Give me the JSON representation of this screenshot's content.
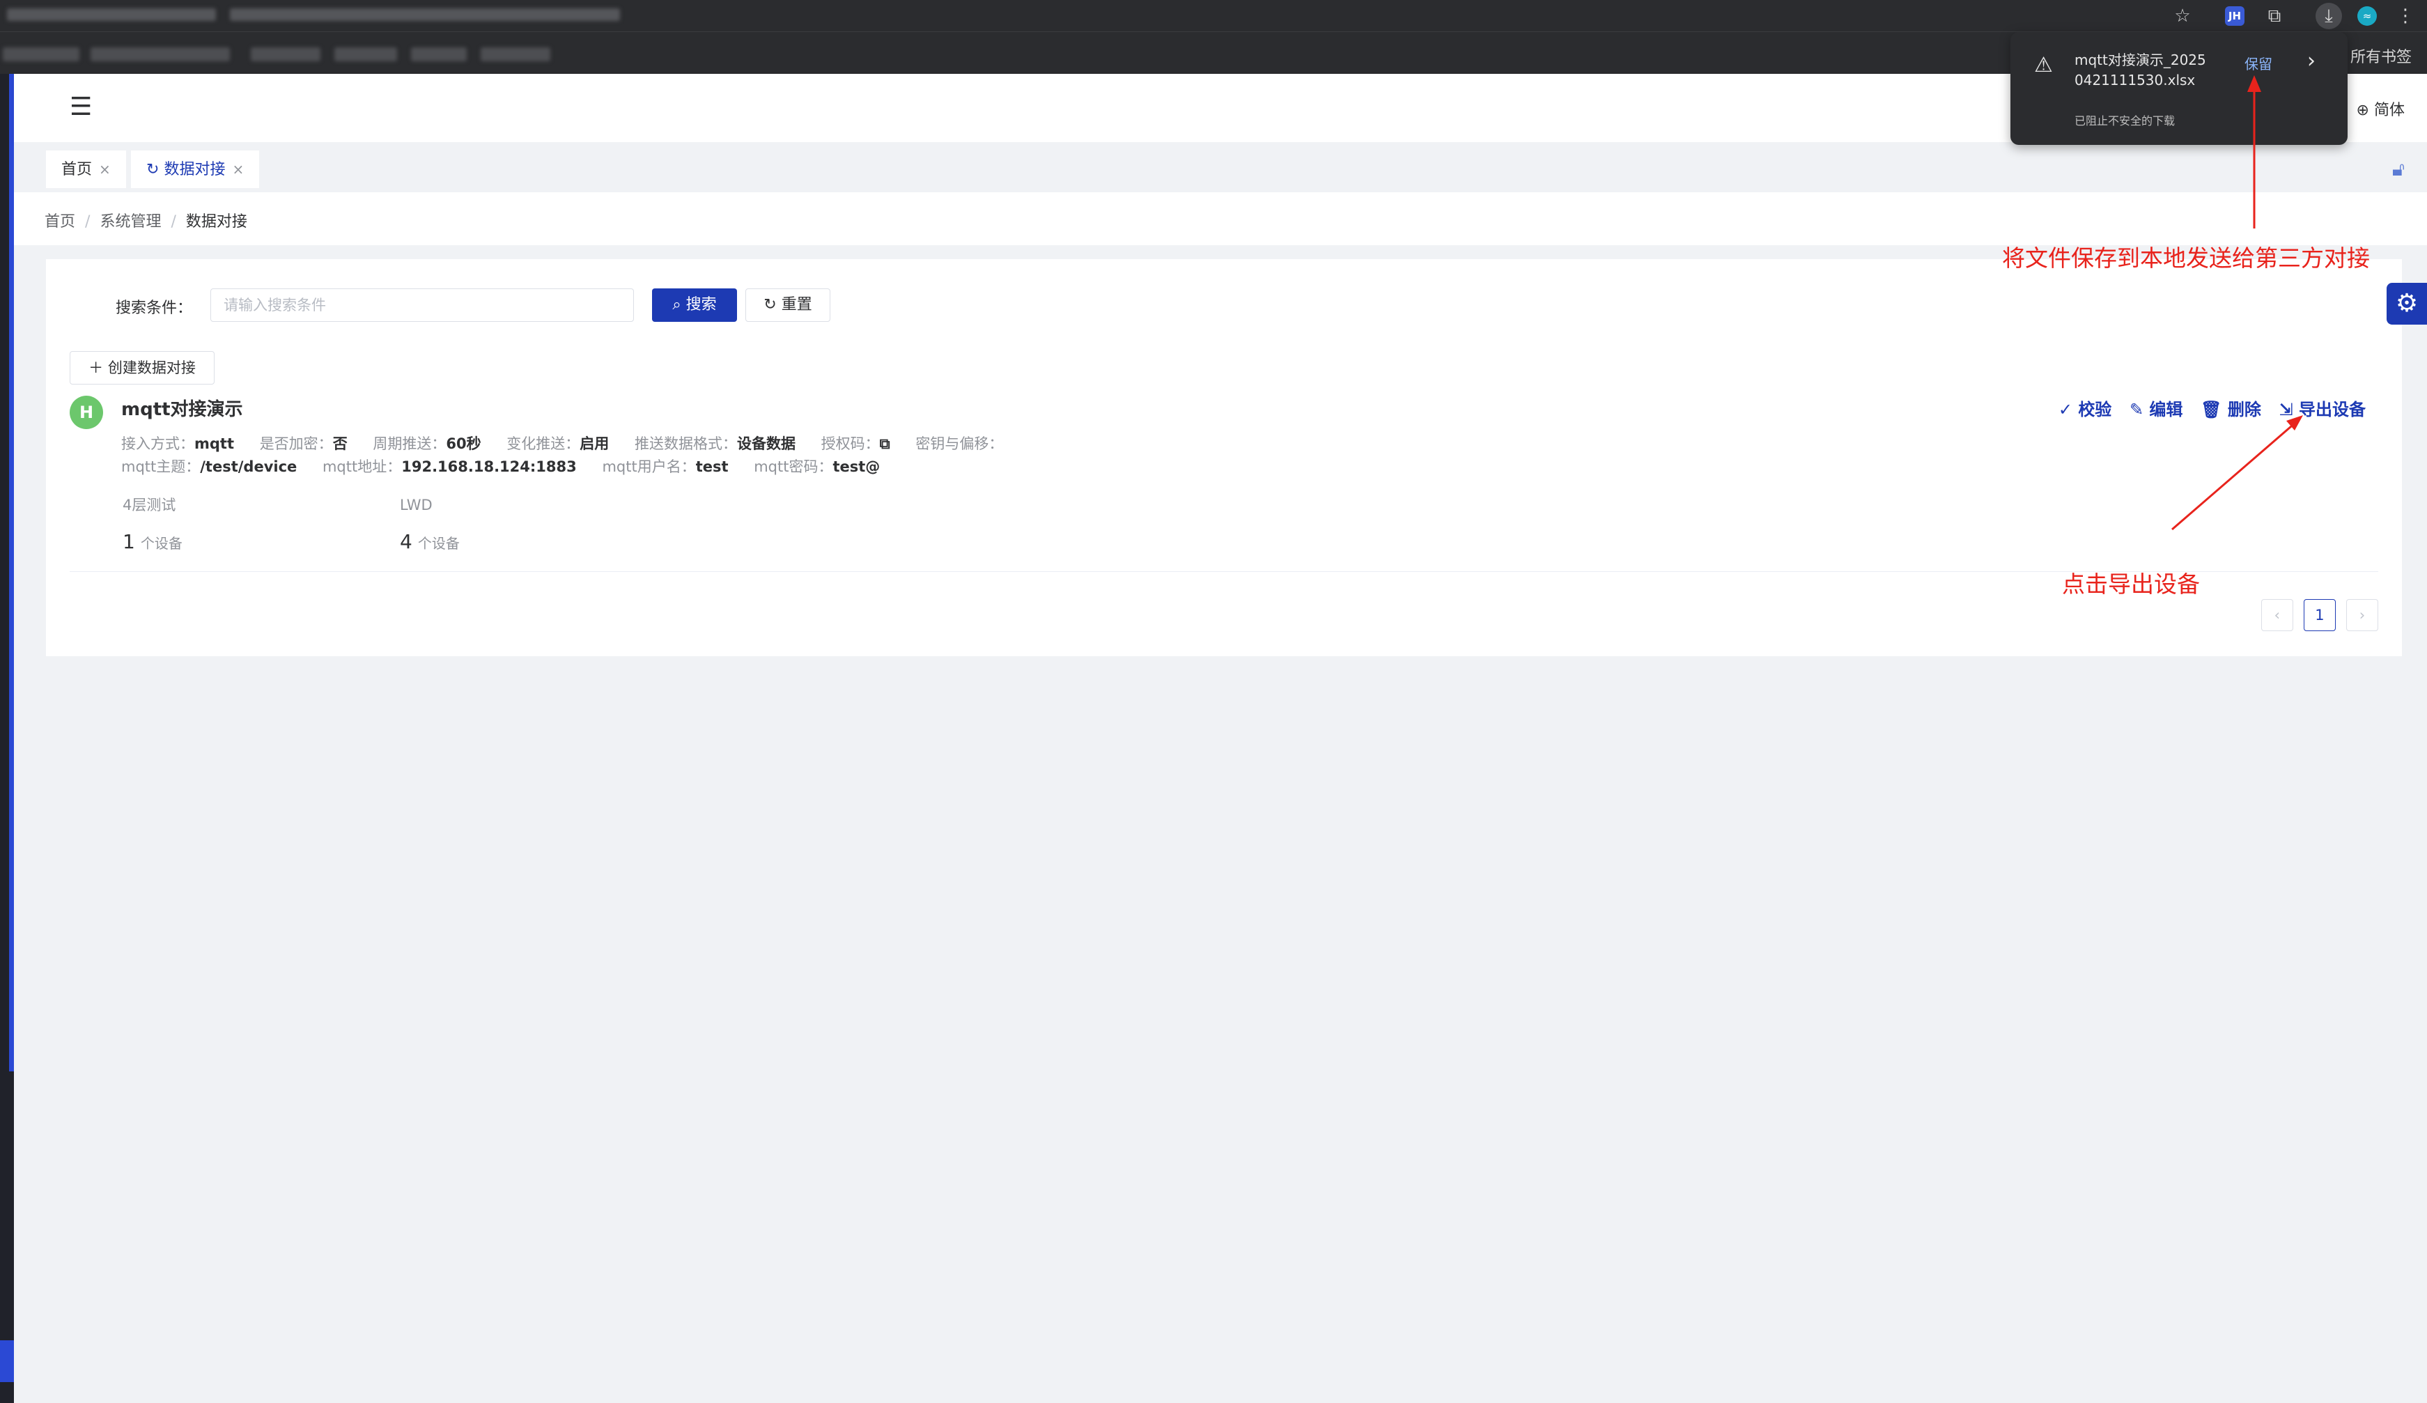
{
  "browser": {
    "all_bookmarks": "所有书签",
    "profile_jh": "JH",
    "avatar_initial": "≈"
  },
  "download_popup": {
    "filename": "mqtt对接演示_20250421111530.xlsx",
    "status": "已阻止不安全的下载",
    "keep_label": "保留"
  },
  "header": {
    "language": "简体"
  },
  "tabs": [
    {
      "label": "首页"
    },
    {
      "label": "数据对接"
    }
  ],
  "breadcrumb": [
    "首页",
    "系统管理",
    "数据对接"
  ],
  "search": {
    "label": "搜索条件：",
    "placeholder": "请输入搜索条件",
    "value": "",
    "search_button": "搜索",
    "reset_button": "重置"
  },
  "create_button": "创建数据对接",
  "item": {
    "logo_text": "H",
    "title": "mqtt对接演示",
    "actions": {
      "verify": "校验",
      "edit": "编辑",
      "delete": "删除",
      "export": "导出设备"
    },
    "fields_row1": [
      {
        "key": "接入方式：",
        "value": "mqtt"
      },
      {
        "key": "是否加密：",
        "value": "否"
      },
      {
        "key": "周期推送：",
        "value": "60秒"
      },
      {
        "key": "变化推送：",
        "value": "启用"
      },
      {
        "key": "推送数据格式：",
        "value": "设备数据"
      },
      {
        "key": "授权码：",
        "value": ""
      },
      {
        "key": "密钥与偏移：",
        "value": ""
      }
    ],
    "fields_row2": [
      {
        "key": "mqtt主题：",
        "value": "/test/device"
      },
      {
        "key": "mqtt地址：",
        "value": "192.168.18.124:1883"
      },
      {
        "key": "mqtt用户名：",
        "value": "test"
      },
      {
        "key": "mqtt密码：",
        "value": "test@"
      }
    ],
    "groups": [
      {
        "name": "4层测试",
        "count": "1",
        "unit": "个设备"
      },
      {
        "name": "LWD",
        "count": "4",
        "unit": "个设备"
      }
    ]
  },
  "pagination": {
    "current": "1"
  },
  "annotations": {
    "save_note": "将文件保存到本地发送给第三方对接",
    "click_note": "点击导出设备"
  }
}
